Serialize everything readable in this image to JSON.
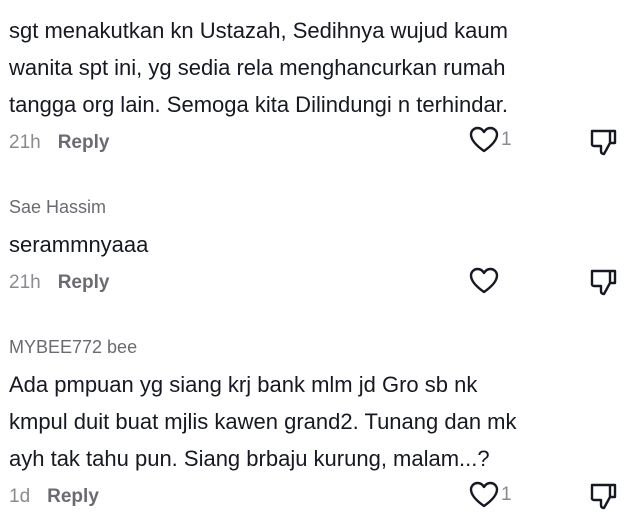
{
  "comments": [
    {
      "author": "",
      "text": "sgt menakutkan kn Ustazah, Sedihnya wujud kaum\nwanita spt ini, yg sedia rela menghancurkan rumah\ntangga org lain. Semoga kita Dilindungi n terhindar.",
      "time": "21h",
      "reply_label": "Reply",
      "like_count": "1"
    },
    {
      "author": "Sae Hassim",
      "text": "serammnyaaa",
      "time": "21h",
      "reply_label": "Reply",
      "like_count": ""
    },
    {
      "author": "MYBEE772 bee",
      "text": "Ada pmpuan yg siang krj bank mlm jd Gro sb nk\nkmpul duit buat mjlis kawen grand2. Tunang dan mk\nayh tak tahu pun. Siang brbaju kurung, malam...?",
      "time": "1d",
      "reply_label": "Reply",
      "like_count": "1"
    }
  ],
  "icons": {
    "like": "heart-outline-icon",
    "dislike": "thumbs-down-icon"
  },
  "colors": {
    "text": "#161823",
    "muted": "#8a8b91",
    "icon": "#161823"
  }
}
